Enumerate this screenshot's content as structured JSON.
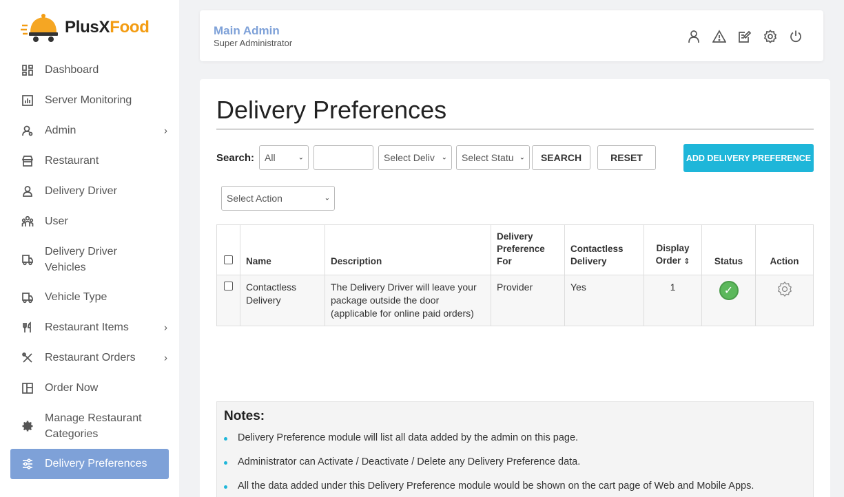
{
  "brand": {
    "name_part1": "PlusX",
    "name_part2": "Food",
    "accent": "#f39c12"
  },
  "sidebar": {
    "items": [
      {
        "label": "Dashboard",
        "icon": "dashboard-icon"
      },
      {
        "label": "Server Monitoring",
        "icon": "chart-icon"
      },
      {
        "label": "Admin",
        "icon": "admin-user-icon",
        "chevron": "›"
      },
      {
        "label": "Restaurant",
        "icon": "store-icon"
      },
      {
        "label": "Delivery Driver",
        "icon": "driver-icon"
      },
      {
        "label": "User",
        "icon": "users-icon"
      },
      {
        "label": "Delivery Driver Vehicles",
        "icon": "vehicle-icon"
      },
      {
        "label": "Vehicle Type",
        "icon": "vehicle-type-icon"
      },
      {
        "label": "Restaurant Items",
        "icon": "fork-knife-icon",
        "chevron": "›"
      },
      {
        "label": "Restaurant Orders",
        "icon": "utensils-cross-icon",
        "chevron": "›"
      },
      {
        "label": "Order Now",
        "icon": "order-icon"
      },
      {
        "label": "Manage Restaurant Categories",
        "icon": "category-gear-icon"
      },
      {
        "label": "Delivery Preferences",
        "icon": "sliders-icon"
      }
    ],
    "active_color": "#7ea1d8"
  },
  "header": {
    "name": "Main Admin",
    "role": "Super Administrator"
  },
  "page": {
    "title": "Delivery Preferences"
  },
  "search": {
    "label": "Search:",
    "field_select": "All",
    "deliver_select": "Select Deliv",
    "status_select": "Select Statu",
    "search_button": "SEARCH",
    "reset_button": "RESET",
    "add_button": "ADD DELIVERY PREFERENCE",
    "add_color": "#1eb6d9"
  },
  "bulk": {
    "action_select": "Select Action"
  },
  "table": {
    "headers": {
      "name": "Name",
      "description": "Description",
      "pref_for": "Delivery Preference For",
      "contactless": "Contactless Delivery",
      "display_order": "Display Order",
      "sort_icon": "⇕",
      "status": "Status",
      "action": "Action"
    },
    "rows": [
      {
        "name": "Contactless Delivery",
        "description": "The Delivery Driver will leave your package outside the door (applicable for online paid orders)",
        "pref_for": "Provider",
        "contactless": "Yes",
        "display_order": "1",
        "status_icon": "active-check-icon",
        "action_icon": "gear-icon"
      }
    ]
  },
  "notes": {
    "title": "Notes:",
    "items": [
      "Delivery Preference module will list all data added by the admin on this page.",
      "Administrator can Activate / Deactivate / Delete any Delivery Preference data.",
      "All the data added under this Delivery Preference module would be shown on the cart page of Web and Mobile Apps."
    ]
  }
}
